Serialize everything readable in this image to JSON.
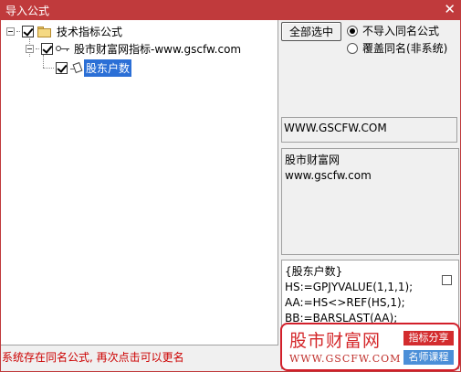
{
  "window": {
    "title": "导入公式",
    "close_glyph": "✕",
    "title_bg": "#c03a3c"
  },
  "tree": {
    "root": {
      "label": "技术指标公式",
      "icon": "folder-icon",
      "checked": true,
      "expanded": true
    },
    "group": {
      "label": "股市财富网指标-www.gscfw.com",
      "icon": "key-icon",
      "checked": true,
      "expanded": true
    },
    "leaf": {
      "label": "股东户数",
      "icon": "formula-icon",
      "checked": true,
      "selected": true
    }
  },
  "options": {
    "select_all_label": "全部选中",
    "radio_skip_label": "不导入同名公式",
    "radio_overwrite_label": "覆盖同名(非系统)",
    "selected": "skip"
  },
  "info": {
    "url": "WWW.GSCFW.COM",
    "desc_line1": "股市财富网",
    "desc_line2": "www.gscfw.com"
  },
  "code": {
    "lines": [
      "{股东户数}",
      "HS:=GPJYVALUE(1,1,1);",
      "AA:=HS<>REF(HS,1);",
      "BB:=BARSLAST(AA);"
    ]
  },
  "status_text": "系统存在同名公式, 再次点击可以更名",
  "watermark": {
    "title": "股市财富网",
    "url": "WWW.GSCFW.COM",
    "badge1": "指标分享",
    "badge2": "名师课程"
  }
}
